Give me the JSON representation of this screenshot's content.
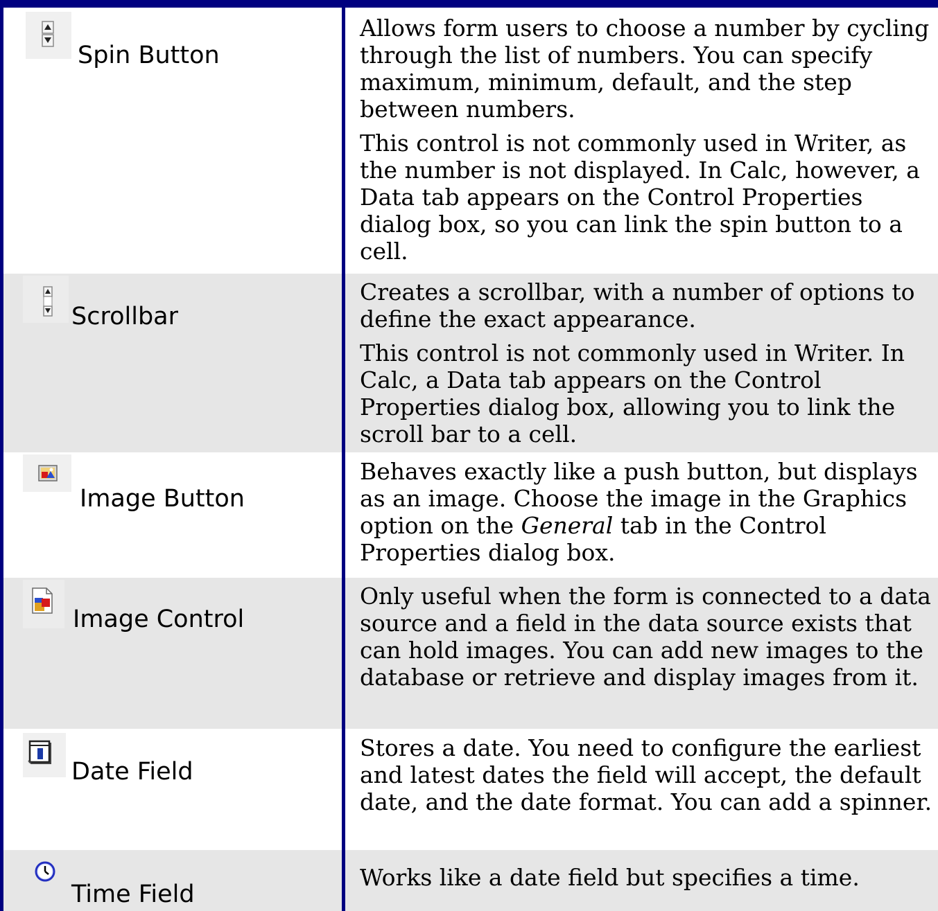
{
  "rows": [
    {
      "name": "Spin Button",
      "icon": "spin-button-icon",
      "paragraphs": [
        "Allows form users to choose a number by cycling through the list of numbers. You can specify maximum, minimum, default, and the step between numbers.",
        "This control is not commonly used in Writer, as the number is not displayed. In Calc, however, a Data tab appears on the Control Properties dialog box, so you can link the spin button to a cell."
      ]
    },
    {
      "name": "Scrollbar",
      "icon": "scrollbar-icon",
      "paragraphs": [
        "Creates a scrollbar, with a number of options to define the exact appearance.",
        "This control is not commonly used in Writer. In Calc, a Data tab appears on the Control Properties dialog box, allowing you to link the scroll bar to a cell."
      ]
    },
    {
      "name": "Image Button",
      "icon": "image-button-icon",
      "paragraphs_parts": {
        "before": "Behaves exactly like a push button, but displays as an image. Choose the image in the Graphics option on the ",
        "italic": "General",
        "after": " tab in the Control Properties dialog box."
      }
    },
    {
      "name": "Image Control",
      "icon": "image-control-icon",
      "paragraphs": [
        "Only useful when the form is connected to a data source and a field in the data source exists that can hold images. You can add new images to the database or retrieve and display images from it."
      ]
    },
    {
      "name": "Date Field",
      "icon": "calendar-icon",
      "paragraphs": [
        "Stores a date. You need to configure the earliest and latest dates the field will accept, the default date, and the date format. You can add a spinner."
      ]
    },
    {
      "name": "Time Field",
      "icon": "clock-icon",
      "paragraphs": [
        "Works like a date field but specifies a time."
      ]
    }
  ]
}
